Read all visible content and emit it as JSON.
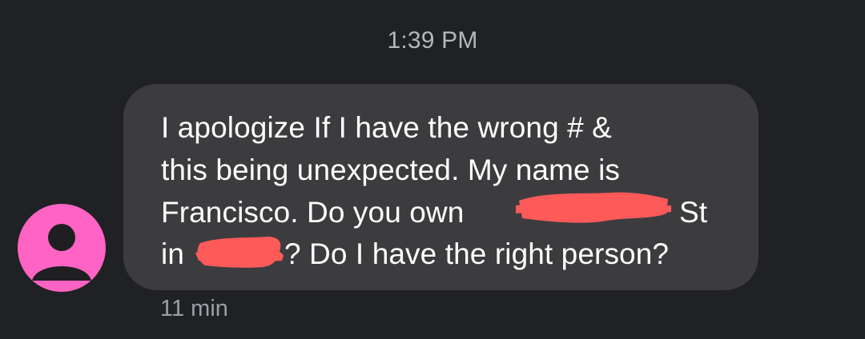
{
  "message": {
    "time_label": "1:39 PM",
    "lines": [
      "I apologize If I have the wrong # &",
      "this being unexpected. My name is",
      "Francisco. Do you own",
      "St",
      "in",
      "? Do I have the right person?"
    ],
    "age_label": "11 min"
  },
  "colors": {
    "background": "#202124",
    "bubble": "#3c3c3f",
    "avatar": "#ff63c3",
    "redaction": "#ff5a5a"
  },
  "icons": {
    "avatar": "person-icon"
  }
}
